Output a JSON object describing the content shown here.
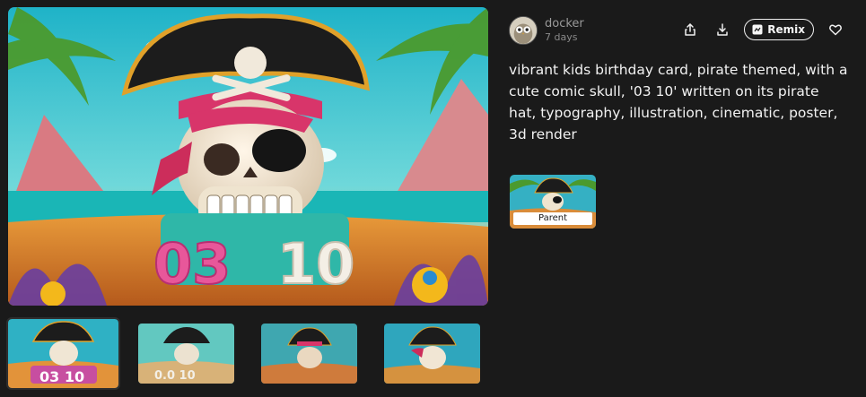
{
  "author": {
    "name": "docker",
    "time": "7 days",
    "avatar_icon": "owl-avatar-icon"
  },
  "actions": {
    "share_icon": "share-icon",
    "download_icon": "download-icon",
    "remix_label": "Remix",
    "remix_icon": "remix-icon",
    "like_icon": "heart-icon"
  },
  "prompt": "vibrant kids birthday card, pirate themed, with a cute comic skull, '03 10' written on its pirate hat, typography, illustration, cinematic, poster, 3d render",
  "parent": {
    "label": "Parent"
  },
  "main_image": {
    "text_on_image": "03 10"
  },
  "thumbnails": [
    {
      "text": "03 10",
      "selected": true
    },
    {
      "text": "0.0 10",
      "selected": false
    },
    {
      "text": "",
      "selected": false
    },
    {
      "text": "",
      "selected": false
    }
  ],
  "colors": {
    "background": "#1a1a1a",
    "text": "#f2f2f2",
    "muted": "#9a9a9a"
  }
}
